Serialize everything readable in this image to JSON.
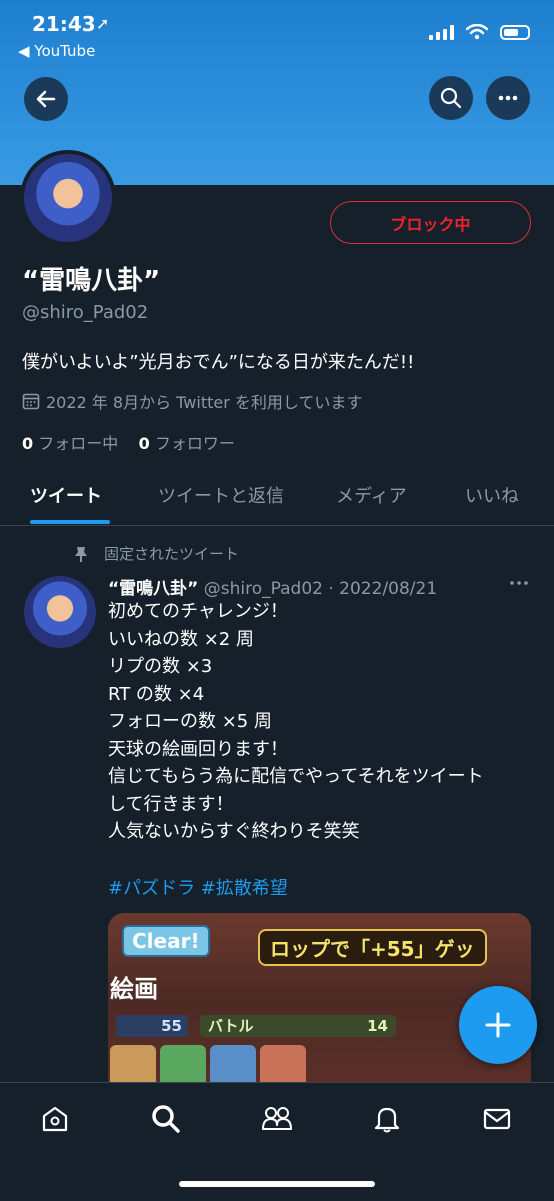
{
  "status_bar": {
    "time": "21:43",
    "back_app": "◀ YouTube"
  },
  "profile": {
    "display_name": "“雷鳴八卦”",
    "handle": "@shiro_Pad02",
    "bio": "僕がいよいよ”光月おでん”になる日が来たんだ!!",
    "joined": "2022 年 8月から Twitter を利用しています",
    "following_count": "0",
    "following_label": "フォロー中",
    "followers_count": "0",
    "followers_label": "フォロワー",
    "block_label": "ブロック中"
  },
  "tabs": [
    {
      "label": "ツイート"
    },
    {
      "label": "ツイートと返信"
    },
    {
      "label": "メディア"
    },
    {
      "label": "いいね"
    }
  ],
  "tweet": {
    "pinned_label": "固定されたツイート",
    "name": "“雷鳴八卦”",
    "meta": "@shiro_Pad02 · 2022/08/21",
    "lines": [
      "初めてのチャレンジ！",
      "いいねの数 ×2 周",
      "リプの数 ×3",
      "RT の数 ×4",
      "フォローの数 ×5 周",
      "天球の絵画回ります！",
      "信じてもらう為に配信でやってそれをツイート",
      "して行きます！",
      "人気ないからすぐ終わりそ笑笑",
      ""
    ],
    "hashtags": "#パズドラ #拡散希望",
    "media": {
      "clear": "Clear!",
      "banner": "ロップで「+55」ゲッ",
      "title": "絵画",
      "stat1": "55",
      "stat2_label": "バトル",
      "stat2_value": "14"
    }
  },
  "colors": {
    "background": "#15202b",
    "accent": "#1d9bf0",
    "block_red": "#f4212e",
    "muted": "#8b98a5"
  }
}
